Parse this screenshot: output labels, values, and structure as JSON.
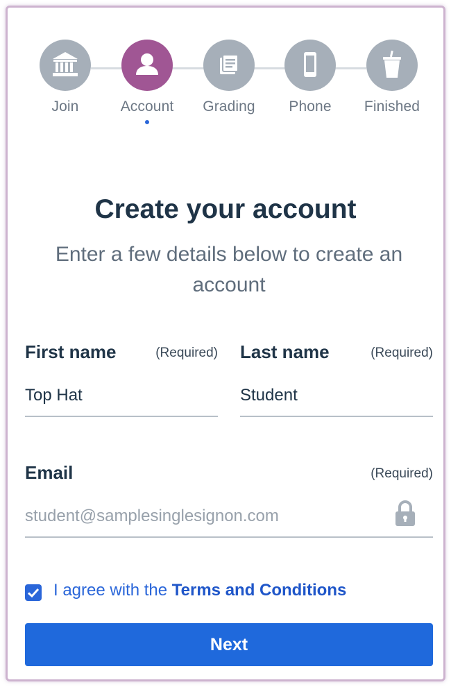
{
  "stepper": {
    "steps": [
      {
        "label": "Join",
        "icon": "bank-icon",
        "active": false
      },
      {
        "label": "Account",
        "icon": "user-icon",
        "active": true
      },
      {
        "label": "Grading",
        "icon": "grading-icon",
        "active": false
      },
      {
        "label": "Phone",
        "icon": "phone-icon",
        "active": false
      },
      {
        "label": "Finished",
        "icon": "cup-icon",
        "active": false
      }
    ],
    "active_color": "#a05694",
    "inactive_color": "#a6afb9"
  },
  "header": {
    "title": "Create your account",
    "subtitle": "Enter a few details below to create an account"
  },
  "form": {
    "first_name": {
      "label": "First name",
      "required": "(Required)",
      "value": "Top Hat"
    },
    "last_name": {
      "label": "Last name",
      "required": "(Required)",
      "value": "Student"
    },
    "email": {
      "label": "Email",
      "required": "(Required)",
      "placeholder": "student@samplesinglesignon.com",
      "icon": "lock-icon"
    },
    "terms": {
      "checked": true,
      "prefix": "I agree with the ",
      "link": "Terms and Conditions"
    },
    "next_label": "Next"
  },
  "colors": {
    "accent": "#1f69dc",
    "heading": "#1f3447"
  }
}
